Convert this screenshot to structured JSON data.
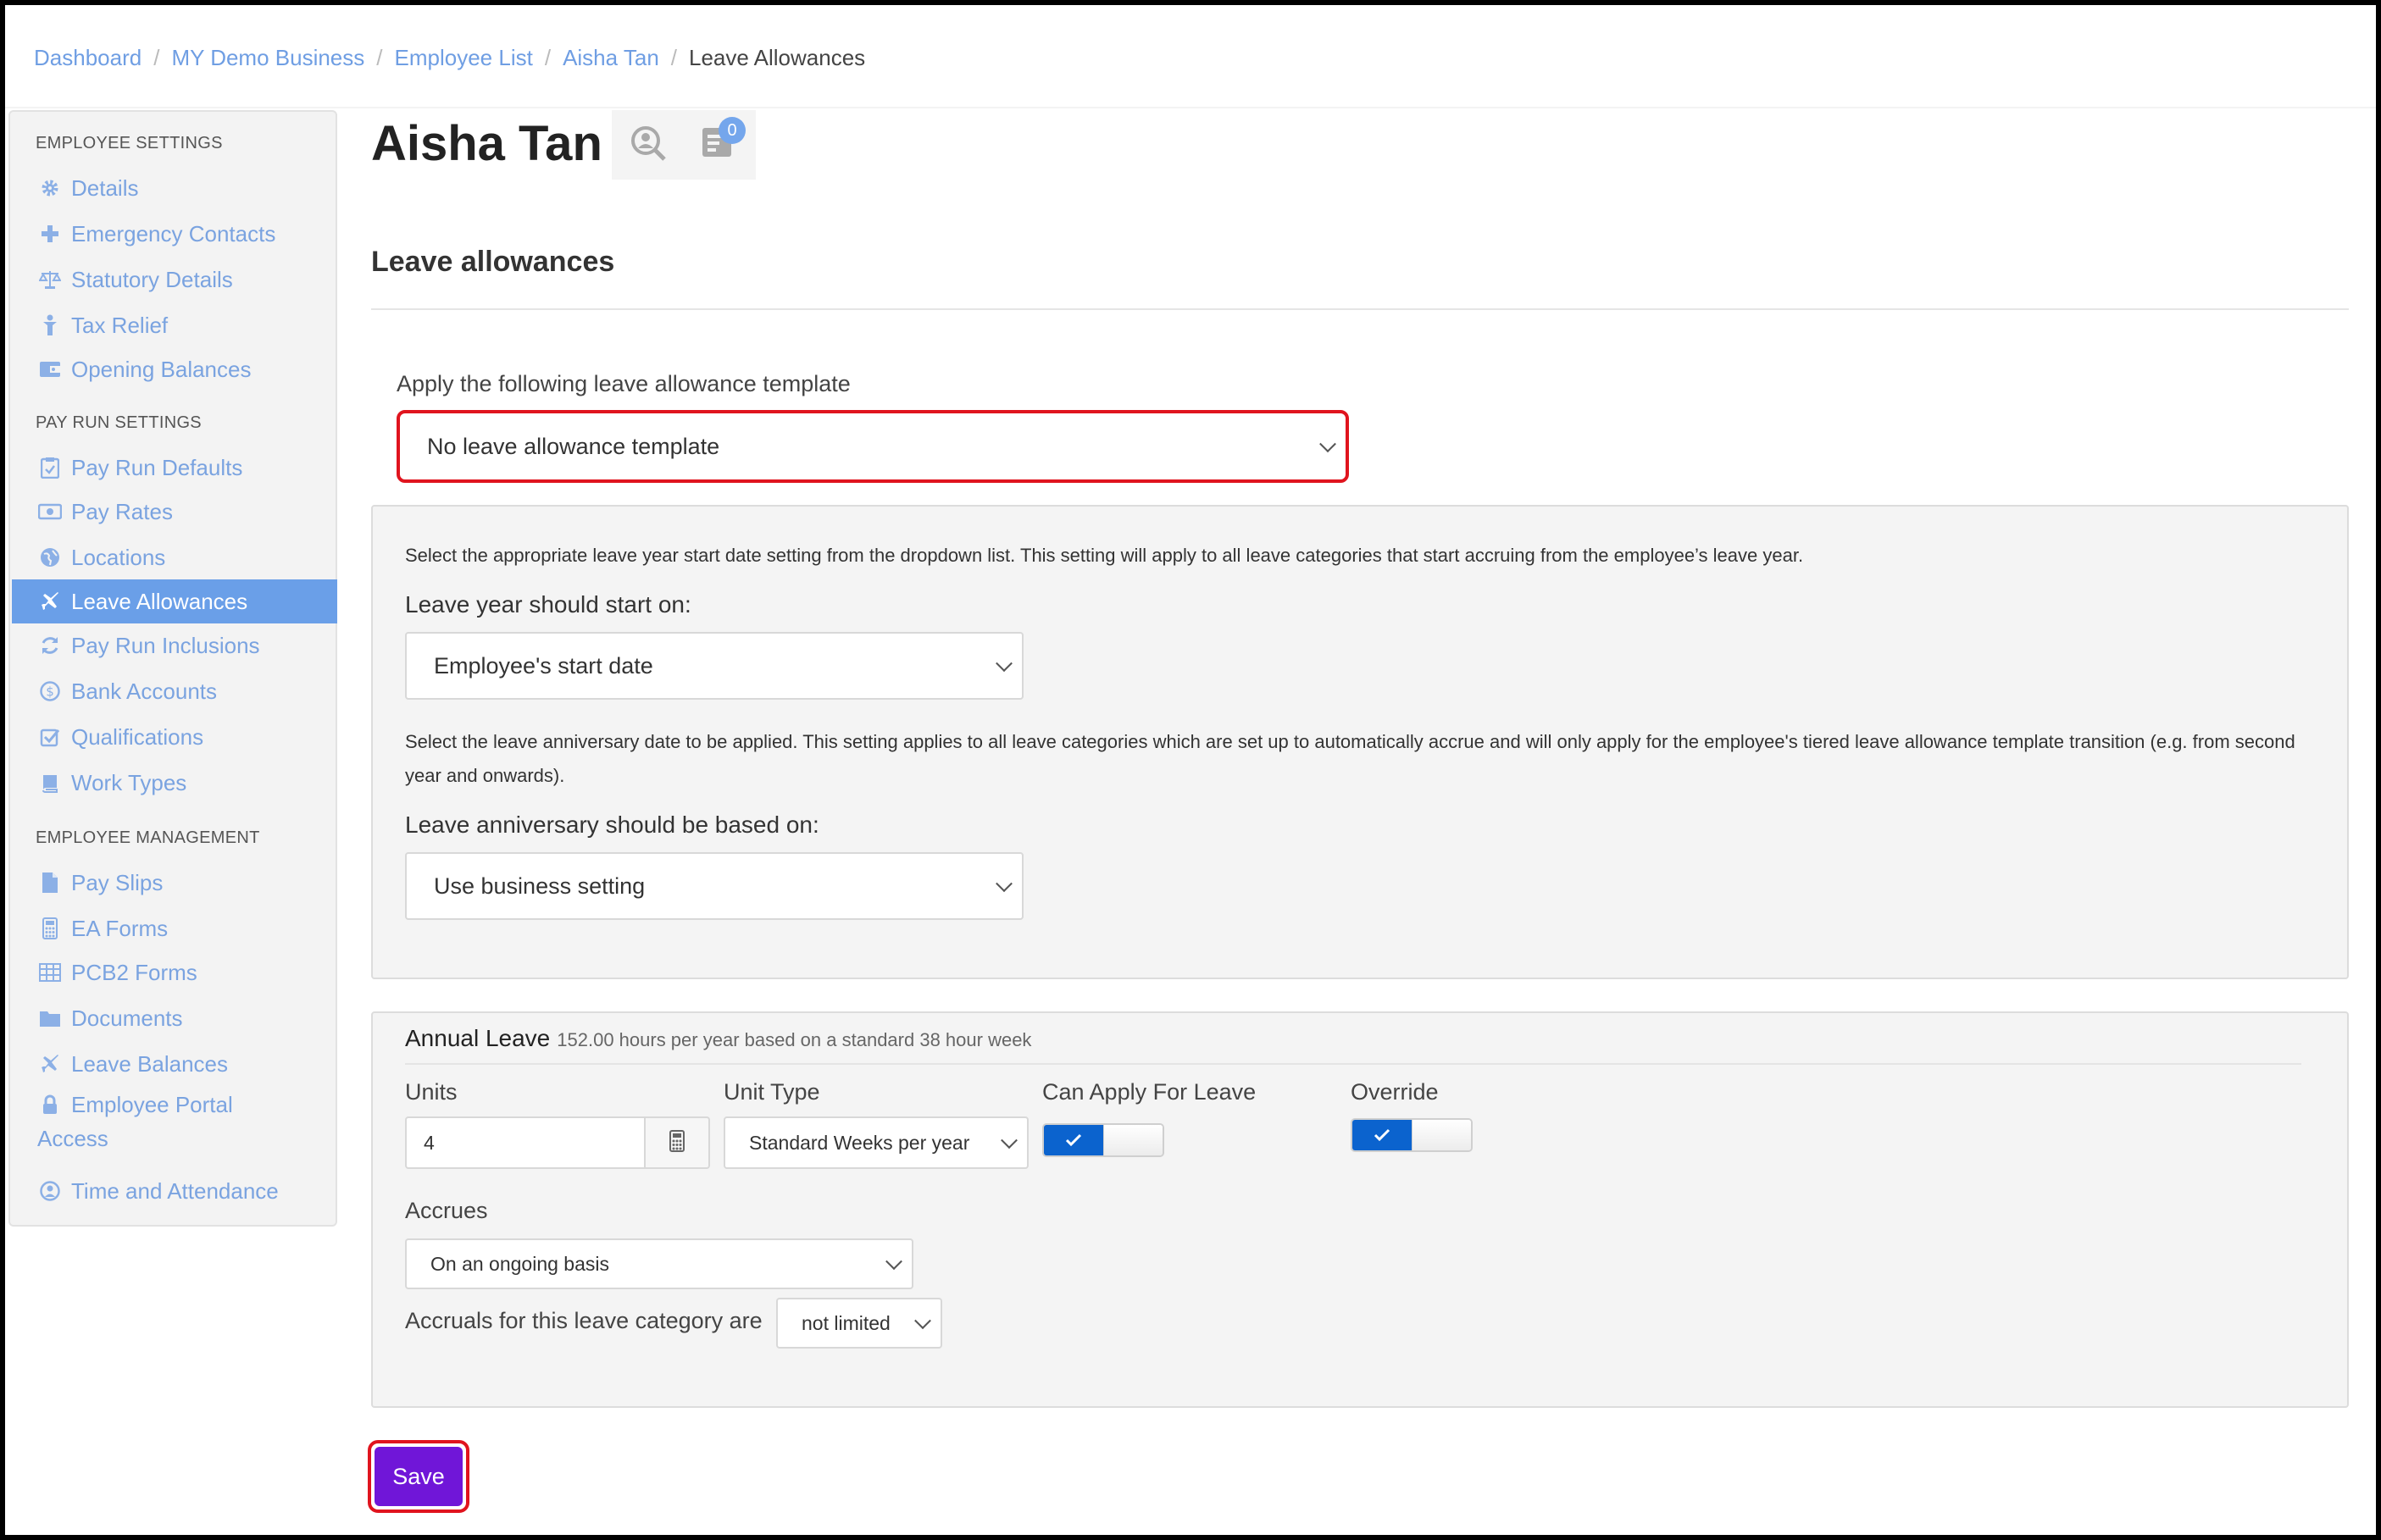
{
  "breadcrumb": {
    "items": [
      "Dashboard",
      "MY Demo Business",
      "Employee List",
      "Aisha Tan"
    ],
    "current": "Leave Allowances",
    "separator": "/"
  },
  "sidebar": {
    "employee_settings": {
      "heading": "EMPLOYEE SETTINGS",
      "items": [
        "Details",
        "Emergency Contacts",
        "Statutory Details",
        "Tax Relief",
        "Opening Balances"
      ]
    },
    "pay_run_settings": {
      "heading": "PAY RUN SETTINGS",
      "items": [
        "Pay Run Defaults",
        "Pay Rates",
        "Locations",
        "Leave Allowances",
        "Pay Run Inclusions",
        "Bank Accounts",
        "Qualifications",
        "Work Types"
      ]
    },
    "employee_management": {
      "heading": "EMPLOYEE MANAGEMENT",
      "items": [
        "Pay Slips",
        "EA Forms",
        "PCB2 Forms",
        "Documents",
        "Leave Balances",
        "Employee Portal Access",
        "Time and Attendance"
      ]
    },
    "active_item": "Leave Allowances"
  },
  "header": {
    "employee_name": "Aisha Tan",
    "notes_badge": "0"
  },
  "section": {
    "title": "Leave allowances",
    "template_label": "Apply the following leave allowance template",
    "template_value": "No leave allowance template"
  },
  "leave_year": {
    "note": "Select the appropriate leave year start date setting from the dropdown list. This setting will apply to all leave categories that start accruing from the employee’s leave year.",
    "label": "Leave year should start on:",
    "value": "Employee's start date"
  },
  "anniversary": {
    "note": "Select the leave anniversary date to be applied. This setting applies to all leave categories which are set up to automatically accrue and will only apply for the employee's tiered leave allowance template transition (e.g. from second year and onwards).",
    "label": "Leave anniversary should be based on:",
    "value": "Use business setting"
  },
  "annual_leave": {
    "title": "Annual Leave",
    "subtitle": "152.00 hours per year based on a standard 38 hour week",
    "units_label": "Units",
    "units_value": "4",
    "unit_type_label": "Unit Type",
    "unit_type_value": "Standard Weeks per year",
    "can_apply_label": "Can Apply For Leave",
    "can_apply_on": true,
    "override_label": "Override",
    "override_on": true,
    "accrues_label": "Accrues",
    "accrues_value": "On an ongoing basis",
    "accruals_label": "Accruals for this leave category are",
    "accruals_value": "not limited"
  },
  "actions": {
    "save_label": "Save"
  },
  "colors": {
    "link": "#6f9ee3",
    "active_nav": "#6a9fe8",
    "highlight": "#e0141e",
    "save_button": "#7016d8",
    "toggle_on": "#0b63ce"
  }
}
